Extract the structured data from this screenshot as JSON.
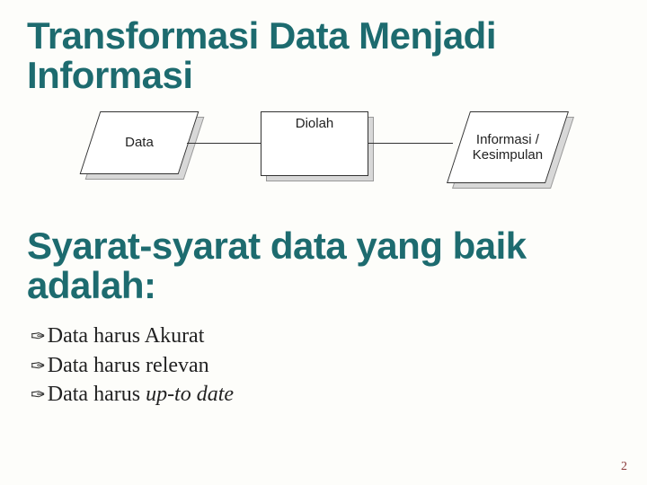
{
  "title": "Transformasi Data Menjadi Informasi",
  "diagram": {
    "node1": "Data",
    "node2": "Diolah",
    "node3": "Informasi / Kesimpulan"
  },
  "subtitle": "Syarat-syarat data yang baik adalah:",
  "bullets": [
    {
      "text": "Data harus Akurat"
    },
    {
      "text": "Data harus relevan"
    },
    {
      "prefix": "Data harus ",
      "italic": "up-to date"
    }
  ],
  "page_number": "2"
}
